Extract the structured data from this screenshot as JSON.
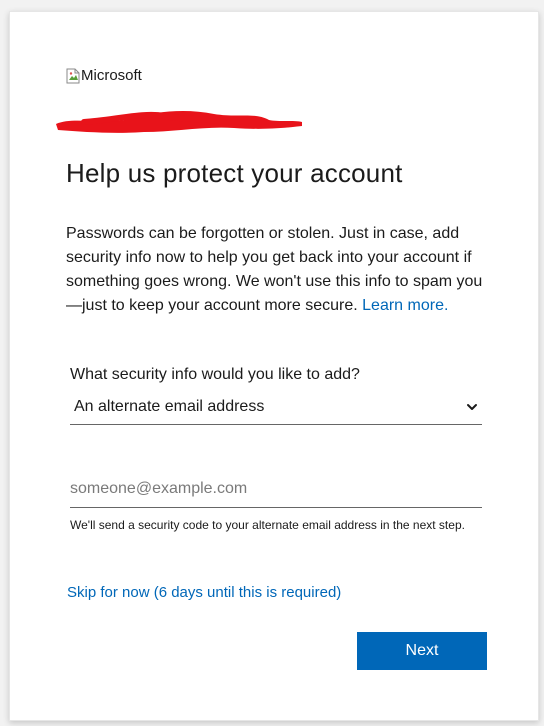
{
  "logo": {
    "alt_text": "Microsoft"
  },
  "page": {
    "title": "Help us protect your account",
    "description": "Passwords can be forgotten or stolen. Just in case, add security info now to help you get back into your account if something goes wrong. We won't use this info to spam you—just to keep your account more secure.",
    "learn_more": "Learn more."
  },
  "security_select": {
    "label": "What security info would you like to add?",
    "selected": "An alternate email address"
  },
  "email_input": {
    "placeholder": "someone@example.com",
    "value": ""
  },
  "hint": "We'll send a security code to your alternate email address in the next step.",
  "skip_link": "Skip for now (6 days until this is required)",
  "next_button": "Next",
  "colors": {
    "accent": "#0067b8",
    "redaction": "#e8131a",
    "text": "#1b1b1b"
  },
  "icons": {
    "logo_placeholder": "broken-image-icon",
    "select_arrow": "chevron-down-icon"
  }
}
